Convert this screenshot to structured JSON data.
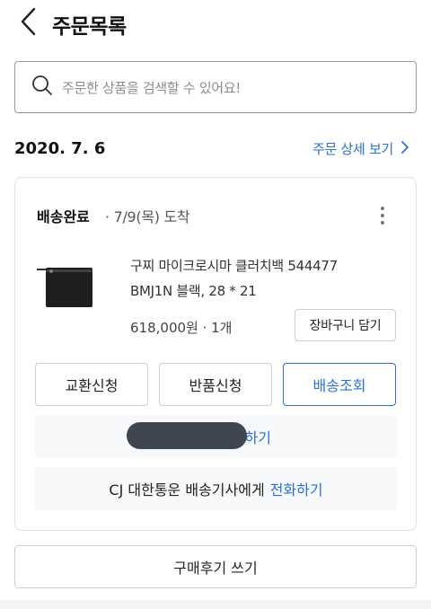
{
  "header": {
    "title": "주문목록"
  },
  "search": {
    "placeholder": "주문한 상품을 검색할 수 있어요!"
  },
  "order": {
    "date": "2020. 7. 6",
    "detail_link": "주문 상세 보기",
    "delivery": {
      "status": "배송완료",
      "arrival": "· 7/9(목) 도착"
    },
    "product": {
      "name": "구찌 마이크로시마 클러치백 544477 BMJ1N 블랙, 28 * 21",
      "price_qty": "618,000원 · 1개"
    },
    "buttons": {
      "add_to_cart": "장바구니 담기",
      "exchange": "교환신청",
      "return": "반품신청",
      "tracking": "배송조회",
      "inquiry": "문의하기"
    },
    "call": {
      "prefix": "CJ 대한통운 배송기사에게",
      "link": "전화하기"
    }
  },
  "review_button": "구매후기 쓰기",
  "colors": {
    "accent": "#2a6fdb",
    "border": "#cfcfcf",
    "panel": "#f7f8fa"
  },
  "icons": {
    "back": "chevron-left-icon",
    "search": "search-icon",
    "more": "more-vertical-icon",
    "link_arrow": "chevron-right-icon"
  }
}
